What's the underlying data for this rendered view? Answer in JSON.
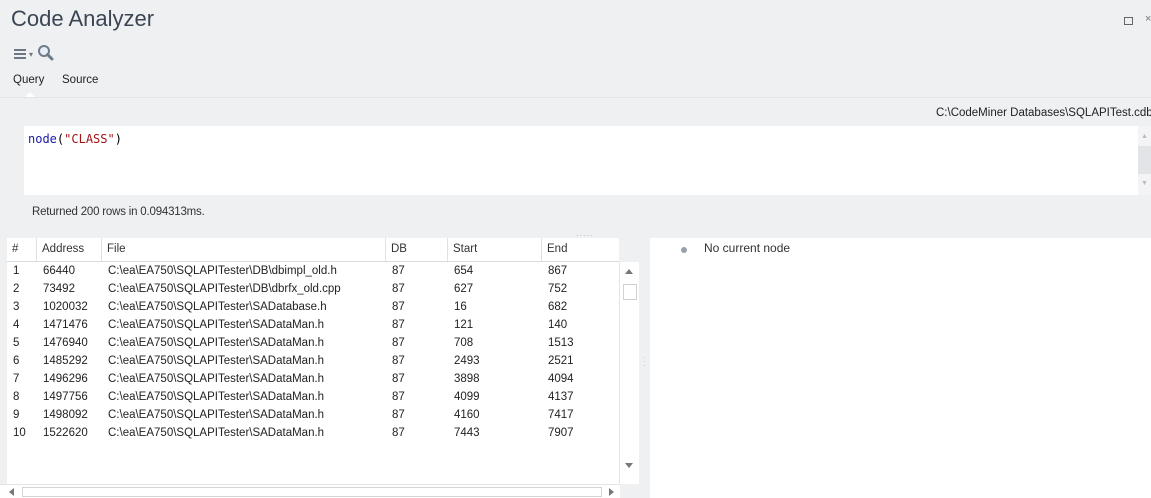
{
  "window": {
    "title": "Code Analyzer",
    "restore_icon": "restore-icon",
    "close_symbol": "×"
  },
  "toolbar": {
    "menu_icon": "hamburger-menu-icon",
    "dropdown_arrow": "▾",
    "search_icon": "search-icon"
  },
  "tabs": [
    {
      "label": "Query",
      "active": true
    },
    {
      "label": "Source",
      "active": false
    }
  ],
  "path": "C:\\CodeMiner Databases\\SQLAPITest.cdb",
  "query": {
    "fn": "node",
    "open": "(",
    "arg": "\"CLASS\"",
    "close": ")"
  },
  "status": "Returned 200 rows in 0.094313ms.",
  "grid": {
    "headers": [
      "#",
      "Address",
      "File",
      "DB",
      "Start",
      "End"
    ],
    "rows": [
      [
        "1",
        "66440",
        "C:\\ea\\EA750\\SQLAPITester\\DB\\dbimpl_old.h",
        "87",
        "654",
        "867"
      ],
      [
        "2",
        "73492",
        "C:\\ea\\EA750\\SQLAPITester\\DB\\dbrfx_old.cpp",
        "87",
        "627",
        "752"
      ],
      [
        "3",
        "1020032",
        "C:\\ea\\EA750\\SQLAPITester\\SADatabase.h",
        "87",
        "16",
        "682"
      ],
      [
        "4",
        "1471476",
        "C:\\ea\\EA750\\SQLAPITester\\SADataMan.h",
        "87",
        "121",
        "140"
      ],
      [
        "5",
        "1476940",
        "C:\\ea\\EA750\\SQLAPITester\\SADataMan.h",
        "87",
        "708",
        "1513"
      ],
      [
        "6",
        "1485292",
        "C:\\ea\\EA750\\SQLAPITester\\SADataMan.h",
        "87",
        "2493",
        "2521"
      ],
      [
        "7",
        "1496296",
        "C:\\ea\\EA750\\SQLAPITester\\SADataMan.h",
        "87",
        "3898",
        "4094"
      ],
      [
        "8",
        "1497756",
        "C:\\ea\\EA750\\SQLAPITester\\SADataMan.h",
        "87",
        "4099",
        "4137"
      ],
      [
        "9",
        "1498092",
        "C:\\ea\\EA750\\SQLAPITester\\SADataMan.h",
        "87",
        "4160",
        "7417"
      ],
      [
        "10",
        "1522620",
        "C:\\ea\\EA750\\SQLAPITester\\SADataMan.h",
        "87",
        "7443",
        "7907"
      ]
    ]
  },
  "node_panel": {
    "message": "No current node"
  }
}
